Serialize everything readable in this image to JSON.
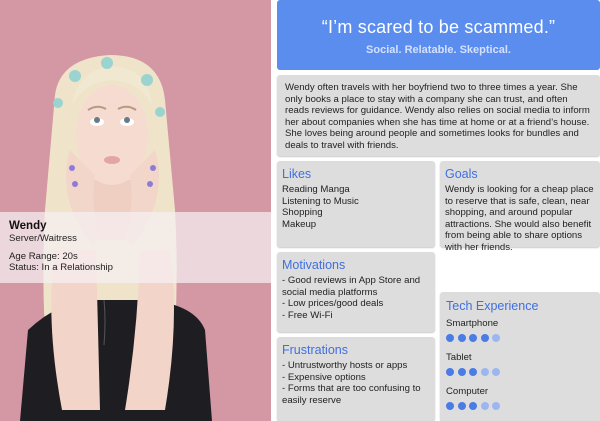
{
  "persona": {
    "name": "Wendy",
    "occupation": "Server/Waitress",
    "age_range": "Age Range: 20s",
    "status": "Status: In a Relationship"
  },
  "quote": {
    "text": "“I’m scared to be scammed.”",
    "tagline": "Social. Relatable. Skeptical."
  },
  "bio": "Wendy often travels with her boyfriend two to three times a year. She only books a place to stay with a company she can trust, and often reads reviews for guidance. Wendy also relies on social media to inform her about companies when she has time at home or at a friend’s house. She loves being around people and sometimes looks for bundles and deals to travel with friends.",
  "likes": {
    "title": "Likes",
    "items": [
      "Reading Manga",
      "Listening to Music",
      "Shopping",
      "Makeup"
    ]
  },
  "goals": {
    "title": "Goals",
    "text": "Wendy is looking for a cheap place to reserve that is safe, clean, near shopping, and around popular attractions. She would also benefit from being able to share options with her friends."
  },
  "motivations": {
    "title": "Motivations",
    "items": [
      "- Good reviews in App Store and social media platforms",
      "- Low prices/good deals",
      "- Free Wi-Fi"
    ]
  },
  "frustrations": {
    "title": "Frustrations",
    "items": [
      "- Untrustworthy hosts or apps",
      "- Expensive options",
      "- Forms that are too confusing to easily reserve"
    ]
  },
  "tech": {
    "title": "Tech Experience",
    "devices": [
      {
        "label": "Smartphone",
        "level": 4,
        "max": 5
      },
      {
        "label": "Tablet",
        "level": 3,
        "max": 5
      },
      {
        "label": "Computer",
        "level": 3,
        "max": 5
      }
    ]
  },
  "colors": {
    "accent": "#5b8dee",
    "heading": "#3f6fe0",
    "dot_on": "#4b7be5",
    "dot_off": "#9db6f0",
    "panel": "#dddddd"
  }
}
